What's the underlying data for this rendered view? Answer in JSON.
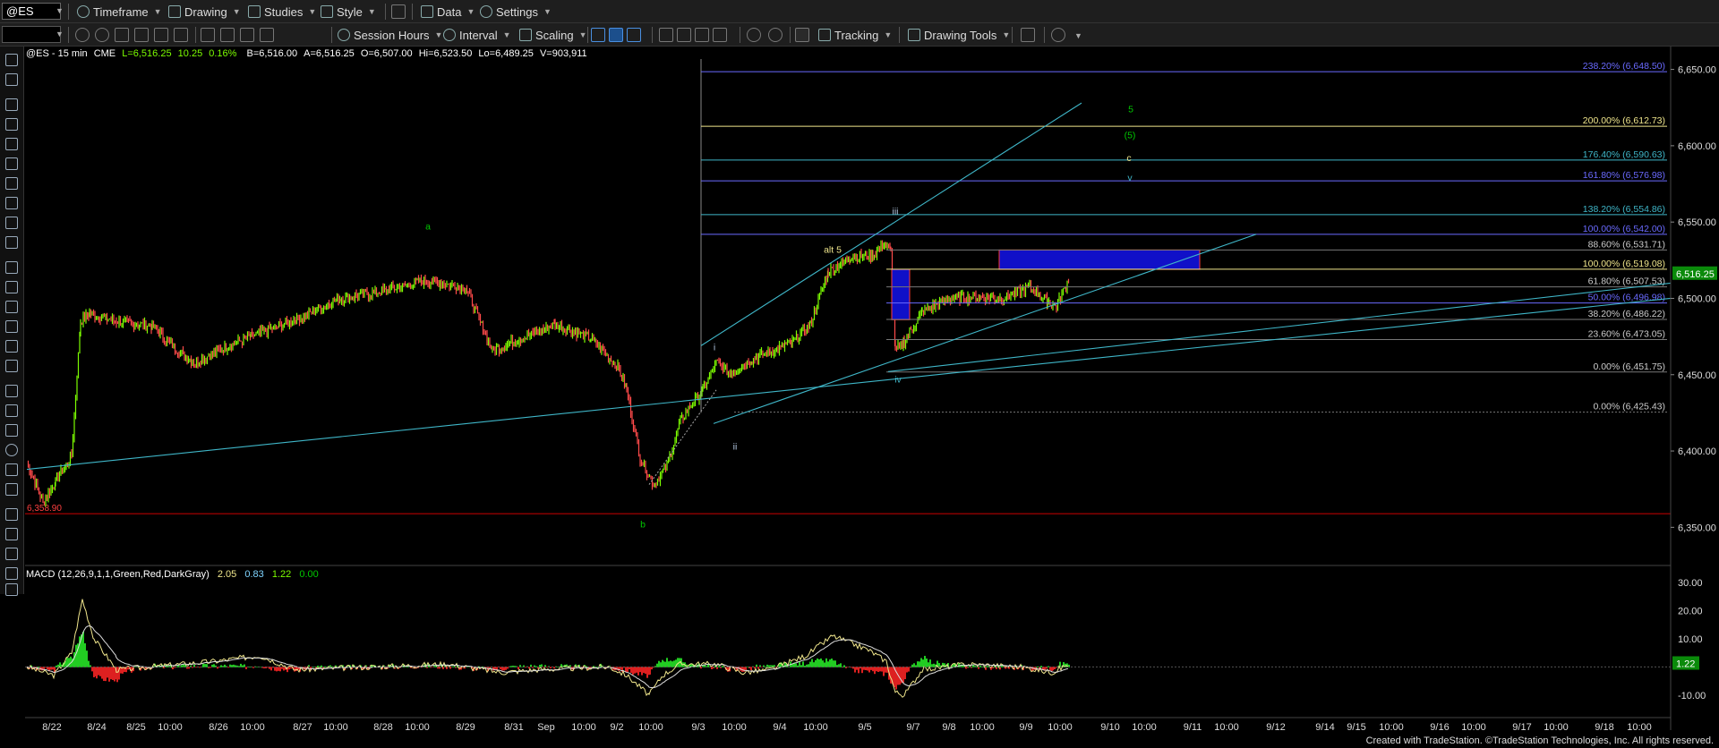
{
  "toolbar1": {
    "symbol": "@ES",
    "timeframe": "Timeframe",
    "drawing": "Drawing",
    "studies": "Studies",
    "style": "Style",
    "data": "Data",
    "settings": "Settings"
  },
  "toolbar2": {
    "session_hours": "Session Hours",
    "interval": "Interval",
    "scaling": "Scaling",
    "tracking": "Tracking",
    "drawing_tools": "Drawing Tools"
  },
  "chart_header": {
    "symbol": "@ES - 15 min",
    "exchange": "CME",
    "last": "L=6,516.25",
    "change": "10.25",
    "change_pct": "0.16%",
    "bid": "B=6,516.00",
    "ask": "A=6,516.25",
    "open": "O=6,507.00",
    "high": "Hi=6,523.50",
    "low": "Lo=6,489.25",
    "volume": "V=903,911"
  },
  "macd_header": {
    "name": "MACD (12,26,9,1,1,Green,Red,DarkGray)",
    "v1": "2.05",
    "v2": "0.83",
    "v3": "1.22",
    "v4": "0.00"
  },
  "colors": {
    "up_bar": "#7CFC00",
    "down_bar": "#ff4a4a",
    "fib": "#4169e1",
    "trendline": "#3fb6c8",
    "yellow": "#f0e68c",
    "label_green": "#00c800"
  },
  "price_axis": {
    "ticks": [
      {
        "v": 6650,
        "label": "6,650.00"
      },
      {
        "v": 6600,
        "label": "6,600.00"
      },
      {
        "v": 6550,
        "label": "6,550.00"
      },
      {
        "v": 6500,
        "label": "6,500.00"
      },
      {
        "v": 6450,
        "label": "6,450.00"
      },
      {
        "v": 6400,
        "label": "6,400.00"
      },
      {
        "v": 6350,
        "label": "6,350.00"
      }
    ],
    "last_price": "6,516.25",
    "range": [
      6325,
      6665
    ]
  },
  "macd_axis": {
    "ticks": [
      {
        "v": 30,
        "label": "30.00"
      },
      {
        "v": 20,
        "label": "20.00"
      },
      {
        "v": 10,
        "label": "10.00"
      },
      {
        "v": -10,
        "label": "-10.00"
      }
    ],
    "last_value": "1.22",
    "range": [
      -18,
      36
    ]
  },
  "time_axis": {
    "labels": [
      "8/22",
      "8/24",
      "8/25",
      "10:00",
      "8/26",
      "10:00",
      "8/27",
      "10:00",
      "8/28",
      "10:00",
      "8/29",
      "8/31",
      "Sep",
      "10:00",
      "9/2",
      "10:00",
      "9/3",
      "10:00",
      "9/4",
      "10:00",
      "9/5",
      "9/7",
      "9/8",
      "10:00",
      "9/9",
      "10:00",
      "9/10",
      "10:00",
      "9/11",
      "10:00",
      "9/12",
      "9/14",
      "9/15",
      "10:00",
      "9/16",
      "10:00",
      "9/17",
      "10:00",
      "9/18",
      "10:00"
    ]
  },
  "fib_levels": [
    {
      "label": "238.20% (6,648.50)",
      "price": 6648.5,
      "color": "#6a6aff"
    },
    {
      "label": "200.00% (6,612.73)",
      "price": 6612.73,
      "color": "#f0e68c"
    },
    {
      "label": "176.40% (6,590.63)",
      "price": 6590.63,
      "color": "#3fb6c8"
    },
    {
      "label": "161.80% (6,576.98)",
      "price": 6576.98,
      "color": "#6a6aff"
    },
    {
      "label": "138.20% (6,554.86)",
      "price": 6554.86,
      "color": "#3fb6c8"
    },
    {
      "label": "100.00% (6,542.00)",
      "price": 6542.0,
      "color": "#6a6aff"
    },
    {
      "label": "88.60% (6,531.71)",
      "price": 6531.71,
      "color": "#ccc"
    },
    {
      "label": "100.00% (6,519.08)",
      "price": 6519.08,
      "color": "#f0e68c"
    },
    {
      "label": "61.80% (6,507.53)",
      "price": 6507.53,
      "color": "#ccc"
    },
    {
      "label": "50.00% (6,496.98)",
      "price": 6496.98,
      "color": "#6a6aff"
    },
    {
      "label": "38.20% (6,486.22)",
      "price": 6486.22,
      "color": "#ccc"
    },
    {
      "label": "23.60% (6,473.05)",
      "price": 6473.05,
      "color": "#ccc"
    },
    {
      "label": "0.00% (6,451.75)",
      "price": 6451.75,
      "color": "#ccc"
    },
    {
      "label": "0.00% (6,425.43)",
      "price": 6425.43,
      "color": "#ccc"
    }
  ],
  "wave_labels": [
    {
      "text": "a",
      "color": "#00c800"
    },
    {
      "text": "b",
      "color": "#00c800"
    },
    {
      "text": "i",
      "color": "#b0c4de"
    },
    {
      "text": "ii",
      "color": "#b0c4de"
    },
    {
      "text": "iii",
      "color": "#b0c4de"
    },
    {
      "text": "iv",
      "color": "#3fb6c8"
    },
    {
      "text": "alt 5",
      "color": "#f0e68c"
    },
    {
      "text": "5",
      "color": "#00c800"
    },
    {
      "text": "(5)",
      "color": "#00c800"
    },
    {
      "text": "c",
      "color": "#f0e68c"
    },
    {
      "text": "v",
      "color": "#3fb6c8"
    }
  ],
  "low_marker": "6,358.90",
  "footer": "Created with TradeStation. ©TradeStation Technologies, Inc. All rights reserved."
}
